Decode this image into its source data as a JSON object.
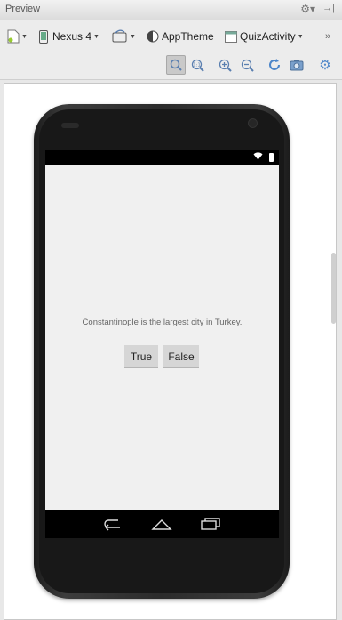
{
  "panel": {
    "title": "Preview"
  },
  "toolbar": {
    "device": "Nexus 4",
    "theme": "AppTheme",
    "activity": "QuizActivity",
    "overflow": "»"
  },
  "zoom": {
    "actual_size_label": "1:1"
  },
  "app": {
    "question": "Constantinople is the largest city in Turkey.",
    "true_button": "True",
    "false_button": "False"
  },
  "colors": {
    "screen_bg": "#f0f0f0",
    "button_bg": "#d6d6d6",
    "bezel": "#2b2b2b"
  }
}
